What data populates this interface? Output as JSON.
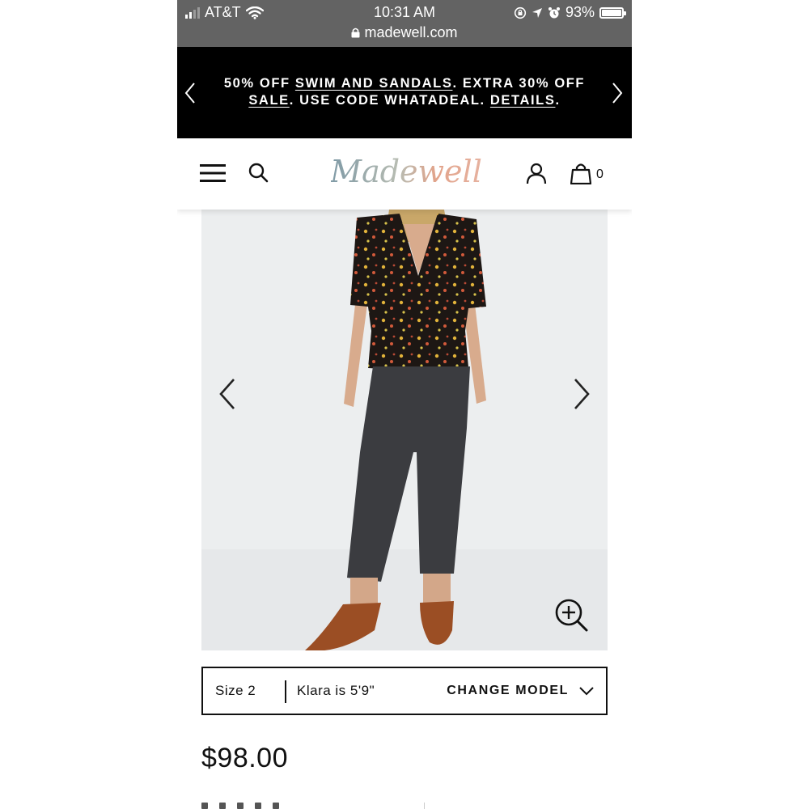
{
  "status_bar": {
    "carrier": "AT&T",
    "time": "10:31 AM",
    "url": "madewell.com",
    "battery": "93%",
    "battery_level": 0.93
  },
  "promo": {
    "part1": "50% OFF ",
    "link1": "SWIM AND SANDALS",
    "part2": ". EXTRA 30% OFF ",
    "link2": "SALE",
    "part3": ". USE CODE WHATADEAL. ",
    "link3": "DETAILS",
    "part4": "."
  },
  "header": {
    "logo": "Madewell",
    "bag_count": "0",
    "logo_colors": [
      "#7f9aa6",
      "#b7bcb2",
      "#e2a38a",
      "#e6b2a0"
    ]
  },
  "model_info": {
    "size": "Size 2",
    "height": "Klara is 5'9\"",
    "change_label": "CHANGE MODEL"
  },
  "product": {
    "price": "$98.00"
  },
  "icons": {
    "menu": "hamburger-icon",
    "search": "search-icon",
    "account": "user-icon",
    "bag": "shopping-bag-icon",
    "zoom": "zoom-in-icon",
    "prev": "chevron-left-icon",
    "next": "chevron-right-icon"
  }
}
